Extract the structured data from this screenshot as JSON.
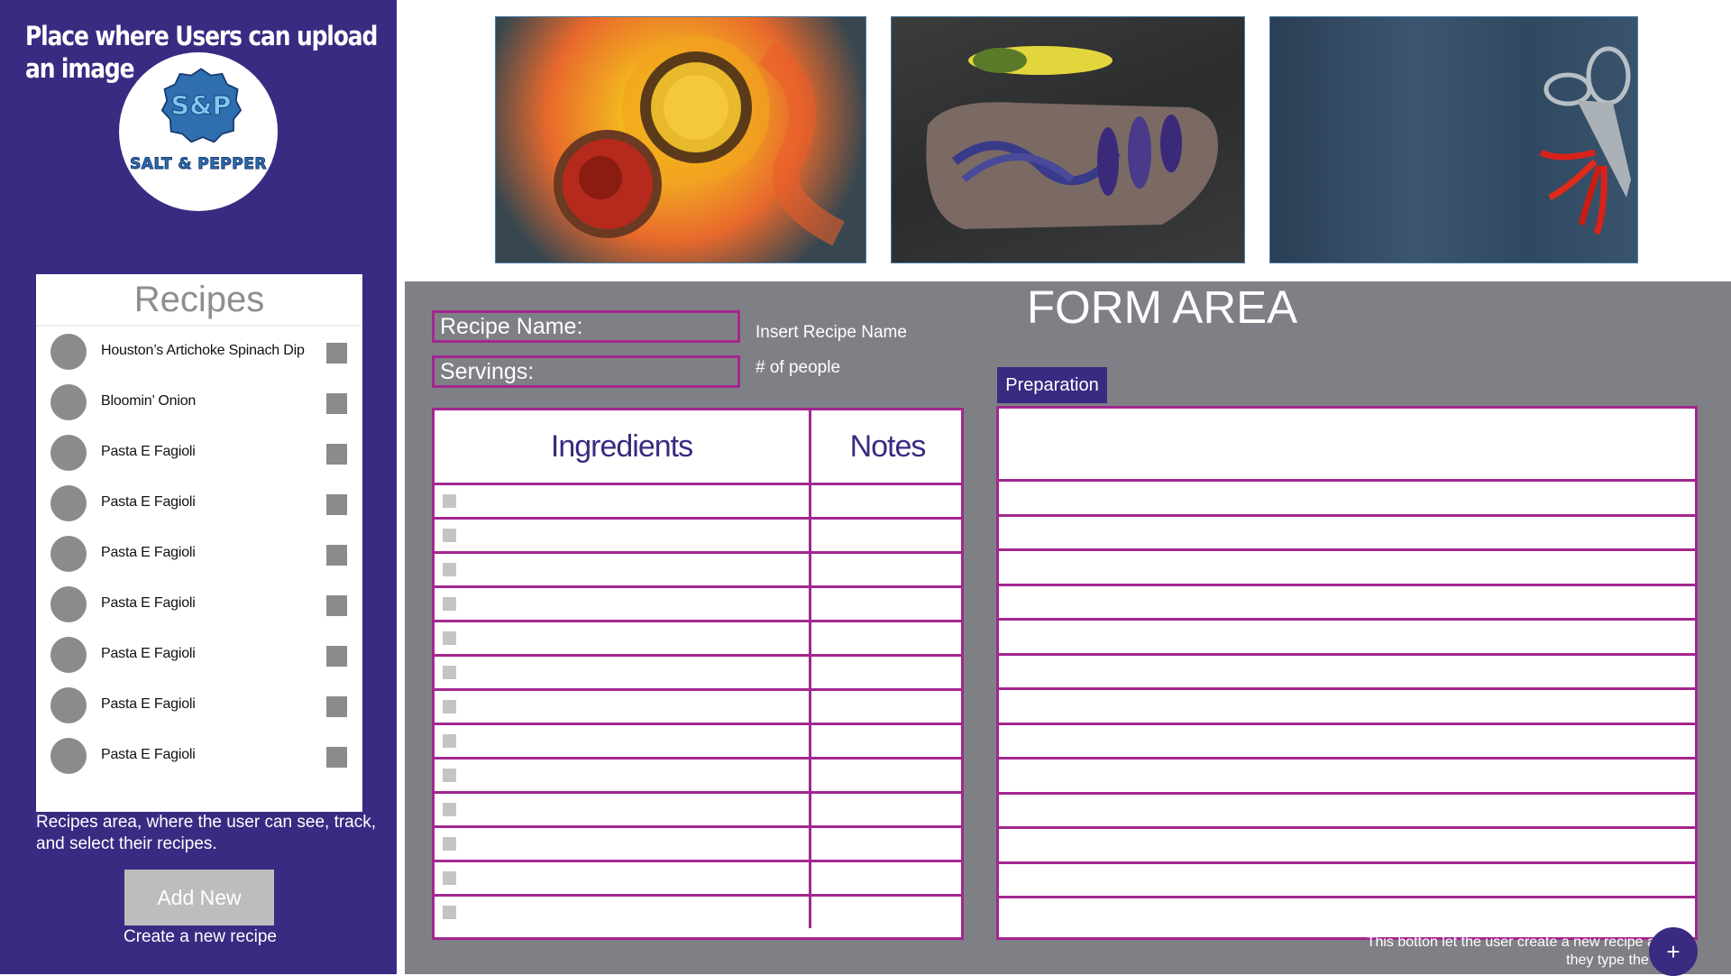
{
  "sidebar": {
    "upload_text": "Place where Users can upload an image",
    "logo": {
      "badge": "S&P",
      "text": "SALT & PEPPER"
    },
    "recipes_title": "Recipes",
    "recipes": [
      "Houston’s Artichoke Spinach Dip",
      "Bloomin’ Onion",
      "Pasta E Fagioli",
      "Pasta E Fagioli",
      "Pasta E Fagioli",
      "Pasta E Fagioli",
      "Pasta E Fagioli",
      "Pasta E Fagioli",
      "Pasta E Fagioli"
    ],
    "recipes_desc": "Recipes area, where the user can see, track, and select their recipes.",
    "add_new_label": "Add New",
    "add_new_caption": "Create a new recipe"
  },
  "images": [
    "spices-photo",
    "vegetables-photo",
    "chili-scissors-photo"
  ],
  "form": {
    "title": "FORM AREA",
    "recipe_name_label": "Recipe Name:",
    "recipe_name_hint": "Insert Recipe Name",
    "servings_label": "Servings:",
    "servings_hint": "# of people",
    "ingredients_header": "Ingredients",
    "notes_header": "Notes",
    "ingredient_rows": 13,
    "preparation_tab": "Preparation",
    "preparation_rows": 13,
    "fab_note": "This botton let the user create a new recipe after they type the info",
    "fab_icon": "+"
  },
  "colors": {
    "brand_purple": "#3a2a82",
    "form_gray": "#7f8085",
    "table_border": "#a3268f",
    "logo_blue": "#2f6fb0"
  }
}
